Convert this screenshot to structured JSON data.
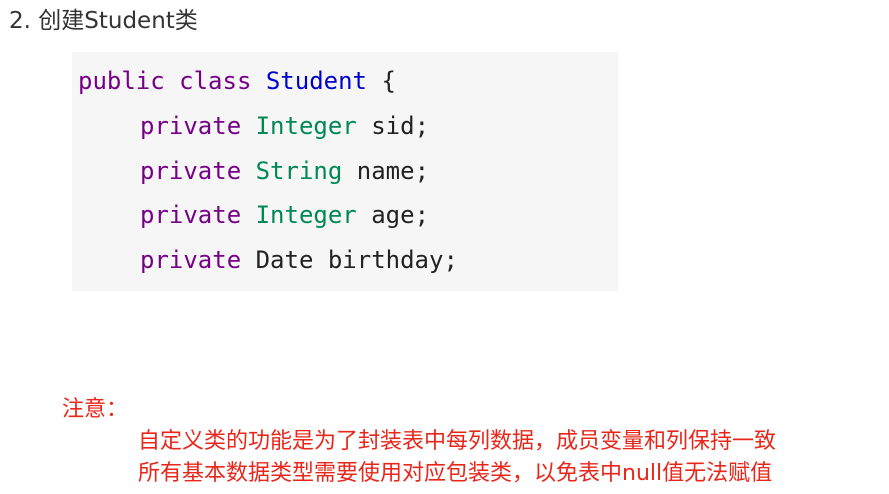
{
  "heading": "2. 创建Student类",
  "code": {
    "line1": {
      "kw1": "public",
      "kw2": "class",
      "class_name": "Student",
      "brace": "{"
    },
    "fields": [
      {
        "modifier": "private",
        "type": "Integer",
        "name": "sid;"
      },
      {
        "modifier": "private",
        "type": "String",
        "name": "name;"
      },
      {
        "modifier": "private",
        "type": "Integer",
        "name": "age;"
      },
      {
        "modifier": "private",
        "type": "Date",
        "name": "birthday;"
      }
    ]
  },
  "note": {
    "title": "注意：",
    "lines": [
      "自定义类的功能是为了封装表中每列数据，成员变量和列保持一致",
      "所有基本数据类型需要使用对应包装类，以免表中null值无法赋值"
    ]
  },
  "colors": {
    "keyword": "#770088",
    "class_name": "#0000cc",
    "type": "#008855",
    "note": "#e8261a",
    "code_background": "#f6f6f6"
  }
}
